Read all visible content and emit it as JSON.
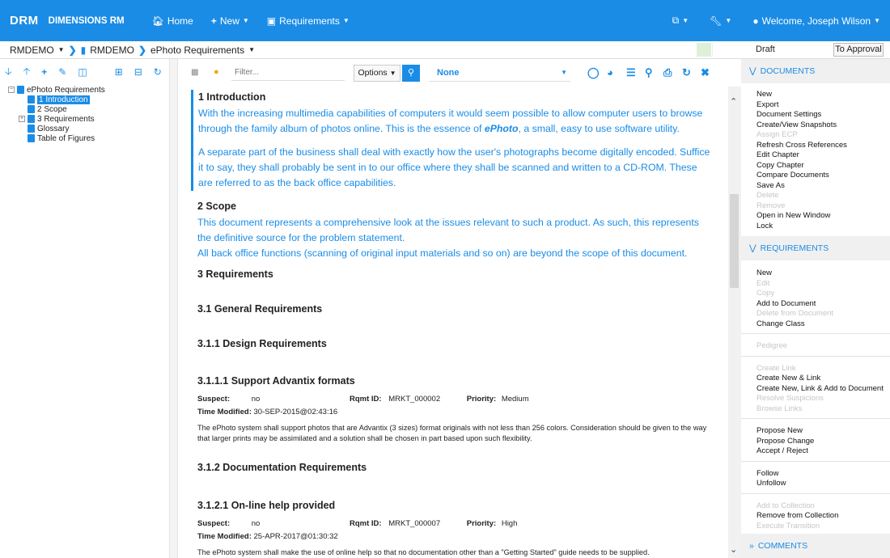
{
  "topbar": {
    "logo": "DRM",
    "product": "DIMENSIONS RM",
    "home": "Home",
    "new": "New",
    "requirements": "Requirements",
    "welcome": "Welcome, Joseph Wilson"
  },
  "crumbbar": {
    "project": "RMDEMO",
    "folder": "RMDEMO",
    "document": "ePhoto Requirements",
    "status": "Draft",
    "approval": "To Approval"
  },
  "tree": {
    "root": "ePhoto Requirements",
    "items": [
      "1 Introduction",
      "2 Scope",
      "3 Requirements",
      "Glossary",
      "Table of Figures"
    ]
  },
  "toolbar": {
    "filter_placeholder": "Filter...",
    "options": "Options",
    "view": "None"
  },
  "document": {
    "intro_title": "1 Introduction",
    "intro_p1a": "With the increasing multimedia capabilities of computers it would seem possible to allow computer users to browse through the family album of photos online. This is the essence of ",
    "intro_brand": "ePhoto",
    "intro_p1b": ", a small, easy to use software utility.",
    "intro_p2": "A separate part of the business shall deal with exactly how the user's photographs become digitally encoded. Suffice it to say, they shall probably be sent in to our office where they shall be scanned and written to a CD-ROM. These are referred to as the back office capabilities.",
    "scope_title": "2 Scope",
    "scope_p1": "This document represents a comprehensive look at the issues relevant to such a product. As such, this represents the definitive source for the problem statement.",
    "scope_p2": "All back office functions (scanning of original input materials and so on) are beyond the scope of this document.",
    "req_title": "3 Requirements",
    "gen_title": "3.1 General Requirements",
    "design_title": "3.1.1 Design Requirements",
    "req1": {
      "title": "3.1.1.1 Support Advantix formats",
      "suspect_label": "Suspect:",
      "suspect": "no",
      "id_label": "Rqmt ID:",
      "id": "MRKT_000002",
      "priority_label": "Priority:",
      "priority": "Medium",
      "time_label": "Time Modified:",
      "time": "30-SEP-2015@02:43:16",
      "text": "The ePhoto system shall support photos that are Advantix (3 sizes) format originals with not less than 256 colors. Consideration should be given to the way that larger prints may be assimilated and a solution shall be chosen in part based upon such flexibility."
    },
    "doc_title": "3.1.2 Documentation Requirements",
    "req2": {
      "title": "3.1.2.1 On-line help provided",
      "suspect_label": "Suspect:",
      "suspect": "no",
      "id_label": "Rqmt ID:",
      "id": "MRKT_000007",
      "priority_label": "Priority:",
      "priority": "High",
      "time_label": "Time Modified:",
      "time": "25-APR-2017@01:30:32",
      "text": "The ePhoto system shall make the use of online help so that no documentation other than a \"Getting Started\" guide needs to be supplied."
    }
  },
  "right": {
    "documents_title": "DOCUMENTS",
    "documents": [
      "New",
      "Export",
      "Document Settings",
      "Create/View Snapshots",
      "Assign ECP",
      "Refresh Cross References",
      "Edit Chapter",
      "Copy Chapter",
      "Compare Documents",
      "Save As",
      "Delete",
      "Remove",
      "Open in New Window",
      "Lock"
    ],
    "requirements_title": "REQUIREMENTS",
    "req_group1": [
      "New",
      "Edit",
      "Copy",
      "Add to Document",
      "Delete from Document",
      "Change Class"
    ],
    "req_group2": [
      "Pedigree"
    ],
    "req_group3": [
      "Create Link",
      "Create New & Link",
      "Create New, Link & Add to Document",
      "Resolve Suspicions",
      "Browse Links"
    ],
    "req_group4": [
      "Propose New",
      "Propose Change",
      "Accept / Reject"
    ],
    "req_group5": [
      "Follow",
      "Unfollow"
    ],
    "req_group6": [
      "Add to Collection",
      "Remove from Collection",
      "Execute Transition"
    ],
    "comments_title": "COMMENTS"
  },
  "colors": {
    "accent": "#1a8ce6",
    "disabled": "#c6c6c6"
  }
}
